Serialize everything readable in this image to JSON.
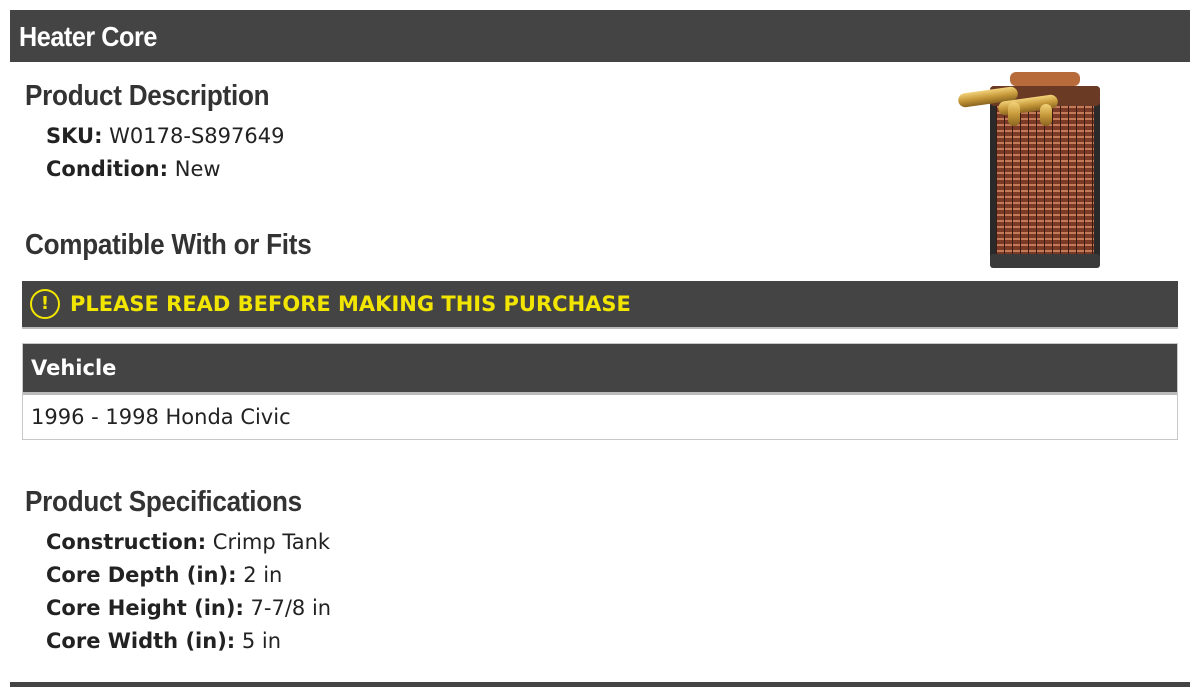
{
  "header": {
    "title": "Heater Core"
  },
  "product_description": {
    "heading": "Product Description",
    "items": [
      {
        "label": "SKU:",
        "value": "W0178-S897649"
      },
      {
        "label": "Condition:",
        "value": "New"
      }
    ]
  },
  "compatibility": {
    "heading": "Compatible With or Fits",
    "warning": {
      "icon": "exclamation-circle-icon",
      "text": "PLEASE READ BEFORE MAKING THIS PURCHASE",
      "color": "#f2e600"
    },
    "table": {
      "header": "Vehicle",
      "rows": [
        "1996 - 1998 Honda Civic"
      ]
    }
  },
  "specifications": {
    "heading": "Product Specifications",
    "items": [
      {
        "label": "Construction:",
        "value": "Crimp Tank"
      },
      {
        "label": "Core Depth (in):",
        "value": "2 in"
      },
      {
        "label": "Core Height (in):",
        "value": "7-7/8 in"
      },
      {
        "label": "Core Width (in):",
        "value": "5 in"
      }
    ]
  },
  "colors": {
    "bar": "#444444",
    "accent": "#f2e600"
  }
}
